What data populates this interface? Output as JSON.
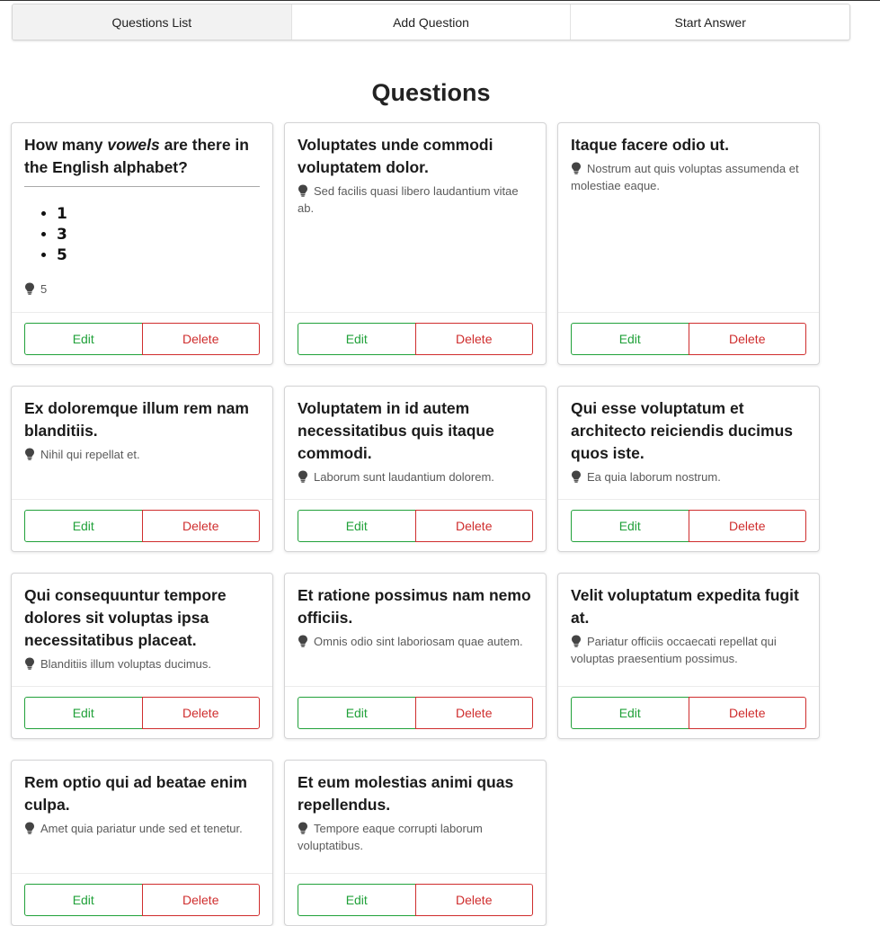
{
  "nav": {
    "items": [
      "Questions List",
      "Add Question",
      "Start Answer"
    ]
  },
  "page": {
    "title": "Questions"
  },
  "colors": {
    "edit": "#21a13a",
    "delete": "#cf2d2d",
    "nav_active": "#f2f2f2"
  },
  "buttons": {
    "edit": "Edit",
    "delete": "Delete"
  },
  "cards": [
    {
      "title_pre": "How many ",
      "title_em": "vowels",
      "title_post": " are there in the English alphabet?",
      "options": [
        "1",
        "3",
        "5"
      ],
      "hint": "5",
      "hint_icon": "lightbulb-icon"
    },
    {
      "title": "Voluptates unde commodi voluptatem dolor.",
      "hint": "Sed facilis quasi libero laudantium vitae ab."
    },
    {
      "title": "Itaque facere odio ut.",
      "hint": "Nostrum aut quis voluptas assumenda et molestiae eaque."
    },
    {
      "title": "Ex doloremque illum rem nam blanditiis.",
      "hint": "Nihil qui repellat et."
    },
    {
      "title": "Voluptatem in id autem necessitatibus quis itaque commodi.",
      "hint": "Laborum sunt laudantium dolorem."
    },
    {
      "title": "Qui esse voluptatum et architecto reiciendis ducimus quos iste.",
      "hint": "Ea quia laborum nostrum."
    },
    {
      "title": "Qui consequuntur tempore dolores sit voluptas ipsa necessitatibus placeat.",
      "hint": "Blanditiis illum voluptas ducimus."
    },
    {
      "title": "Et ratione possimus nam nemo officiis.",
      "hint": "Omnis odio sint laboriosam quae autem."
    },
    {
      "title": "Velit voluptatum expedita fugit at.",
      "hint": "Pariatur officiis occaecati repellat qui voluptas praesentium possimus."
    },
    {
      "title": "Rem optio qui ad beatae enim culpa.",
      "hint": "Amet quia pariatur unde sed et tenetur."
    },
    {
      "title": "Et eum molestias animi quas repellendus.",
      "hint": "Tempore eaque corrupti laborum voluptatibus."
    }
  ]
}
